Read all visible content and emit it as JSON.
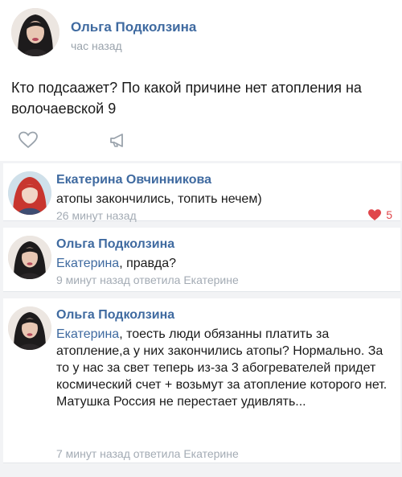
{
  "post": {
    "author": "Ольга Подколзина",
    "time": "час назад",
    "text": "Кто подсаажет? По какой причине нет атопления на волочаевской 9"
  },
  "comments": [
    {
      "author": "Екатерина Овчинникова",
      "text": "атопы закончились, топить нечем)",
      "meta": "26 минут назад",
      "likes": "5"
    },
    {
      "author": "Ольга Подколзина",
      "mention": "Екатерина",
      "text": ", правда?",
      "meta": "9 минут назад ответила Екатерине"
    },
    {
      "author": "Ольга Подколзина",
      "mention": "Екатерина",
      "text": ", тоесть люди обязанны платить за атопление,а у них закончились атопы? Нормально. За то у нас за свет теперь из-за 3 абогревателей придет космический счет + возьмут за атопление которого нет. Матушка Россия не перестает удивлять...",
      "meta": "7 минут назад ответила Екатерине"
    }
  ],
  "colors": {
    "link": "#3f6aa0",
    "muted": "#9aa3ac",
    "like": "#e0464b"
  },
  "icons": [
    "heart-outline-icon",
    "megaphone-share-icon",
    "heart-filled-icon"
  ]
}
